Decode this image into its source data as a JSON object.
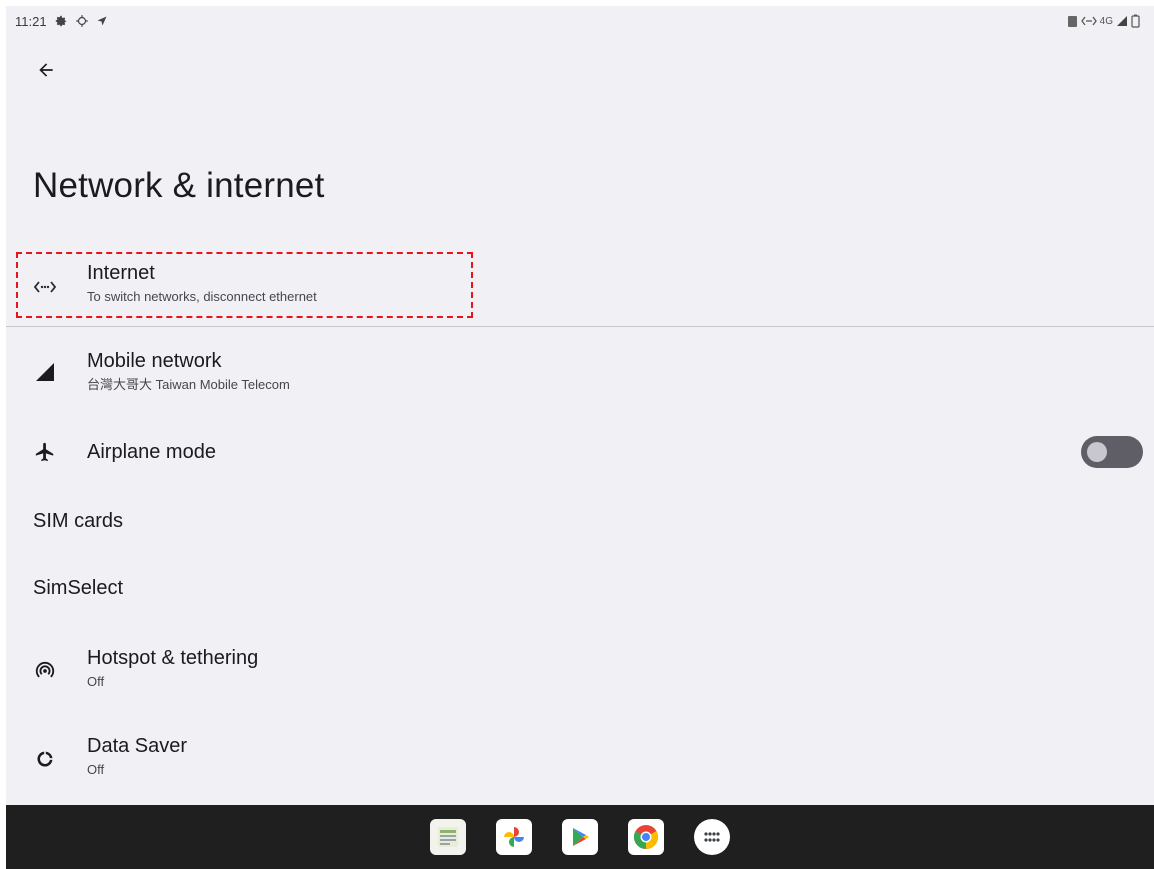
{
  "status_bar": {
    "time": "11:21",
    "network_label": "4G"
  },
  "page": {
    "title": "Network & internet"
  },
  "items": [
    {
      "title": "Internet",
      "subtitle": "To switch networks, disconnect ethernet",
      "icon": "ethernet-icon"
    },
    {
      "title": "Mobile network",
      "subtitle": "台灣大哥大 Taiwan Mobile Telecom",
      "icon": "signal-icon"
    },
    {
      "title": "Airplane mode",
      "icon": "airplane-icon",
      "toggle_on": false
    },
    {
      "title": "SIM cards"
    },
    {
      "title": "SimSelect"
    },
    {
      "title": "Hotspot & tethering",
      "subtitle": "Off",
      "icon": "hotspot-icon"
    },
    {
      "title": "Data Saver",
      "subtitle": "Off",
      "icon": "data-saver-icon"
    }
  ],
  "taskbar": {
    "apps": [
      "sheets-app-icon",
      "photos-app-icon",
      "play-store-icon",
      "chrome-icon",
      "app-drawer-icon"
    ]
  },
  "colors": {
    "background": "#f1f0f5",
    "focus_outline": "#e8141b",
    "taskbar": "#1f1f1f",
    "toggle_track": "#5f5e66"
  }
}
